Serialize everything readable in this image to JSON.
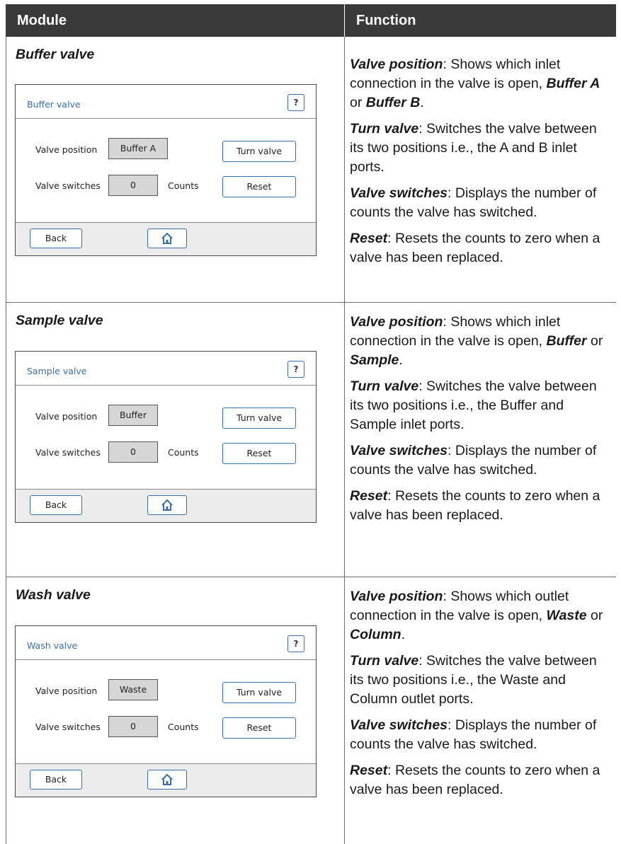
{
  "header": {
    "module": "Module",
    "function": "Function"
  },
  "rows": [
    {
      "title": "Buffer valve",
      "screen": {
        "title": "Buffer valve",
        "help": "?",
        "position_label": "Valve position",
        "position_value": "Buffer A",
        "turn_button": "Turn valve",
        "switches_label": "Valve switches",
        "switches_value": "0",
        "counts_label": "Counts",
        "reset_button": "Reset",
        "back_button": "Back"
      },
      "desc": {
        "p1_term": "Valve position",
        "p1_text": ": Shows which inlet connection in the valve is open, ",
        "p1_opt1": "Buffer A",
        "p1_or": " or ",
        "p1_opt2": "Buffer B",
        "p1_end": ".",
        "p2_term": "Turn valve",
        "p2_text": ": Switches the valve between its two positions i.e., the A and B inlet ports.",
        "p3_term": "Valve switches",
        "p3_text": ": Displays the number of counts the valve has switched.",
        "p4_term": "Reset",
        "p4_text": ": Resets the counts to zero when a valve has been replaced."
      }
    },
    {
      "title": "Sample valve",
      "screen": {
        "title": "Sample valve",
        "help": "?",
        "position_label": "Valve position",
        "position_value": "Buffer",
        "turn_button": "Turn valve",
        "switches_label": "Valve switches",
        "switches_value": "0",
        "counts_label": "Counts",
        "reset_button": "Reset",
        "back_button": "Back"
      },
      "desc": {
        "p1_term": "Valve position",
        "p1_text": ": Shows which inlet connection in the valve is open, ",
        "p1_opt1": "Buffer",
        "p1_or": " or ",
        "p1_opt2": "Sample",
        "p1_end": ".",
        "p2_term": "Turn valve",
        "p2_text": ": Switches the valve between its two positions i.e., the Buffer and Sample inlet ports.",
        "p3_term": "Valve switches",
        "p3_text": ": Displays the number of counts the valve has switched.",
        "p4_term": "Reset",
        "p4_text": ": Resets the counts to zero when a valve has been replaced."
      }
    },
    {
      "title": "Wash valve",
      "screen": {
        "title": "Wash valve",
        "help": "?",
        "position_label": "Valve position",
        "position_value": "Waste",
        "turn_button": "Turn valve",
        "switches_label": "Valve switches",
        "switches_value": "0",
        "counts_label": "Counts",
        "reset_button": "Reset",
        "back_button": "Back"
      },
      "desc": {
        "p1_term": "Valve position",
        "p1_text": ": Shows which outlet connection in the valve is open, ",
        "p1_opt1": "Waste",
        "p1_or": " or ",
        "p1_opt2": "Column",
        "p1_end": ".",
        "p2_term": "Turn valve",
        "p2_text": ": Switches the valve between its two positions i.e., the Waste and Column outlet ports.",
        "p3_term": "Valve switches",
        "p3_text": ": Displays the number of counts the valve has switched.",
        "p4_term": "Reset",
        "p4_text": ": Resets the counts to zero when a valve has been replaced."
      }
    }
  ],
  "colors": {
    "header_bg": "#3a3a3a",
    "link_blue": "#3a6ea8",
    "value_box": "#d6d6d6",
    "footer_bg": "#ececec"
  },
  "icons": {
    "home": "home-icon",
    "help": "question-mark"
  }
}
